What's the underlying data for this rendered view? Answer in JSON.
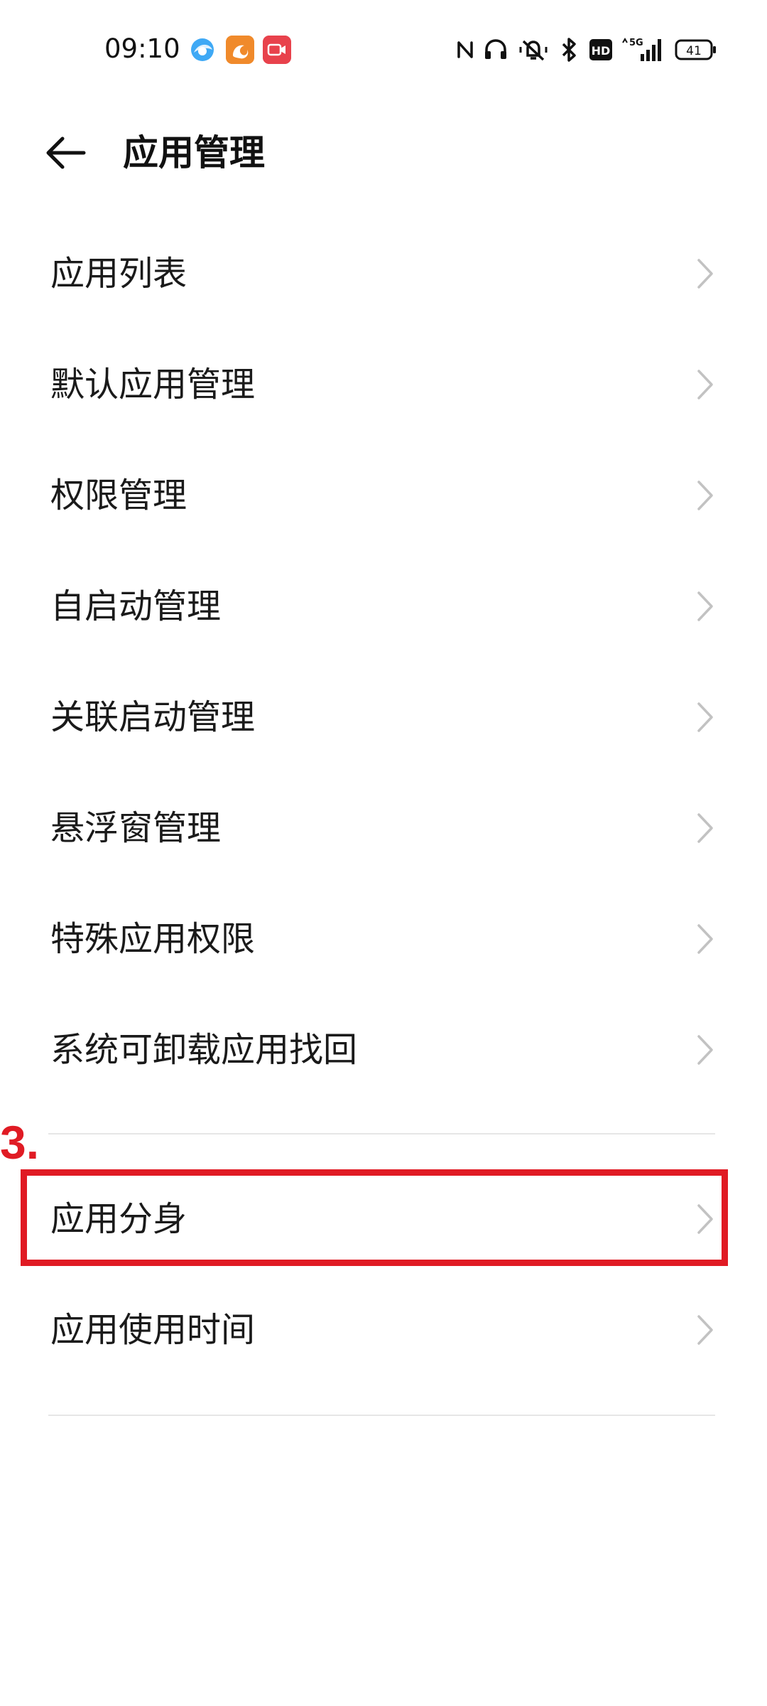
{
  "status_bar": {
    "time": "09:10",
    "battery_level": "41",
    "network": "5G",
    "notification_icons": [
      "browser-icon",
      "uc-browser-icon",
      "video-call-icon"
    ],
    "system_icons": [
      "nfc-icon",
      "headset-icon",
      "mute-icon",
      "bluetooth-icon",
      "hd-icon",
      "signal-5g-icon",
      "battery-icon"
    ]
  },
  "header": {
    "title": "应用管理",
    "back_icon": "arrow-left-icon"
  },
  "menu": {
    "items": [
      {
        "label": "应用列表"
      },
      {
        "label": "默认应用管理"
      },
      {
        "label": "权限管理"
      },
      {
        "label": "自启动管理"
      },
      {
        "label": "关联启动管理"
      },
      {
        "label": "悬浮窗管理"
      },
      {
        "label": "特殊应用权限"
      },
      {
        "label": "系统可卸载应用找回"
      },
      {
        "label": "应用分身"
      },
      {
        "label": "应用使用时间"
      }
    ]
  },
  "annotation": {
    "step_label": "3.",
    "highlight_color": "#e01b24"
  }
}
